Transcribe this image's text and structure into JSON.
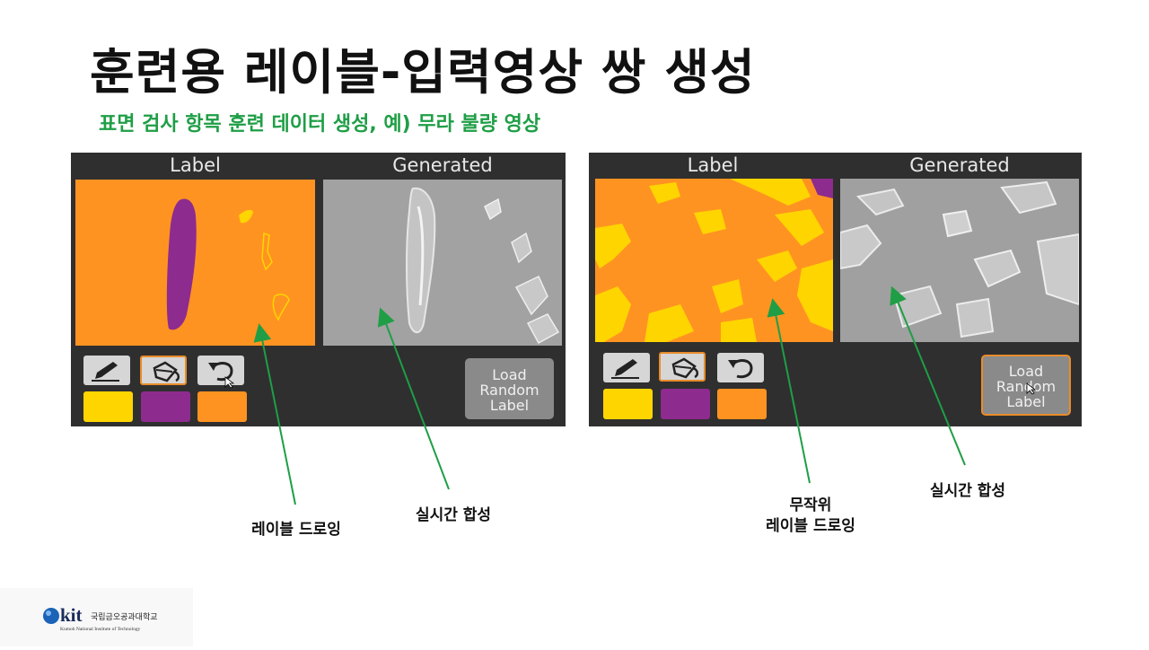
{
  "slide": {
    "title": "훈련용 레이블-입력영상 쌍 생성",
    "subtitle": "표면 검사 항목 훈련 데이터 생성, 예) 무라 불량 영상"
  },
  "panels": [
    {
      "label_tab": "Label",
      "generated_tab": "Generated",
      "load_button": [
        "Load",
        "Random",
        "Label"
      ]
    },
    {
      "label_tab": "Label",
      "generated_tab": "Generated",
      "load_button": [
        "Load",
        "Random",
        "Label"
      ]
    }
  ],
  "annotations": {
    "drawing": "레이블 드로잉",
    "realtime_1": "실시간 합성",
    "random_1": "무작위",
    "random_2": "레이블 드로잉",
    "realtime_2": "실시간 합성"
  },
  "logo": {
    "mark": "kit",
    "name_ko": "국립금오공과대학교",
    "name_en": "Kumoh National Institute of Technology"
  },
  "colors": {
    "swatch_yellow": "#ffd500",
    "swatch_purple": "#8e2b8e",
    "swatch_orange": "#ff9322",
    "annotation_green": "#1f9e46",
    "panel_bg": "#2f2f2f"
  }
}
